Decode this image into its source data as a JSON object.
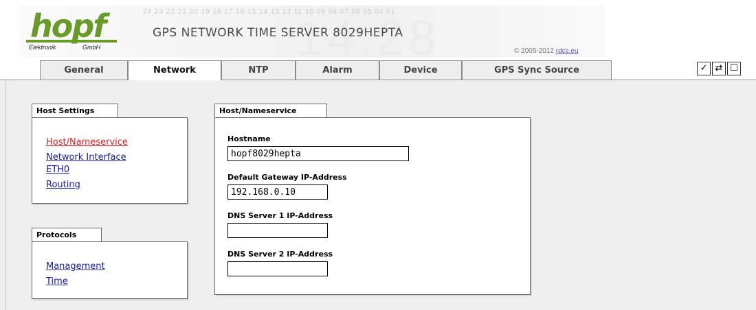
{
  "header": {
    "logo_word": "hopf",
    "logo_sub_left": "Elektronik",
    "logo_sub_right": "GmbH",
    "deco_digits": "24 23 22 21 20 19 18 17 16 15 14 13 12 11 10 09 08 07 06 05 04 01",
    "product_title": "GPS NETWORK TIME SERVER 8029HEPTA",
    "copyright_prefix": "© 2005-2012 ",
    "copyright_link": "rdcs.eu"
  },
  "tabs": [
    {
      "label": "General",
      "active": false
    },
    {
      "label": "Network",
      "active": true
    },
    {
      "label": "NTP",
      "active": false
    },
    {
      "label": "Alarm",
      "active": false
    },
    {
      "label": "Device",
      "active": false
    },
    {
      "label": "GPS Sync Source",
      "active": false
    }
  ],
  "toolbar": {
    "apply_icon": "checkmark-icon",
    "apply_glyph": "✓",
    "reload_icon": "reload-icon",
    "reload_glyph": "⇄",
    "save_icon": "save-icon",
    "save_glyph": "☐"
  },
  "host_settings": {
    "title": "Host Settings",
    "links": [
      {
        "label": "Host/Nameservice",
        "active": true
      },
      {
        "label": "Network Interface",
        "active": false
      },
      {
        "label": "ETH0",
        "active": false
      },
      {
        "label": "Routing",
        "active": false
      }
    ]
  },
  "protocols": {
    "title": "Protocols",
    "links": [
      {
        "label": "Management",
        "active": false
      },
      {
        "label": "Time",
        "active": false
      }
    ]
  },
  "host_nameservice": {
    "title": "Host/Nameservice",
    "hostname_label": "Hostname",
    "hostname_value": "hopf8029hepta",
    "gateway_label": "Default Gateway IP-Address",
    "gateway_value": "192.168.0.10",
    "dns1_label": "DNS Server 1 IP-Address",
    "dns1_value": "",
    "dns2_label": "DNS Server 2 IP-Address",
    "dns2_value": ""
  },
  "colors": {
    "logo_green": "#6a9a2a",
    "link_blue": "#1a1aa6",
    "link_active_red": "#e02020",
    "content_bg": "#efefef"
  }
}
